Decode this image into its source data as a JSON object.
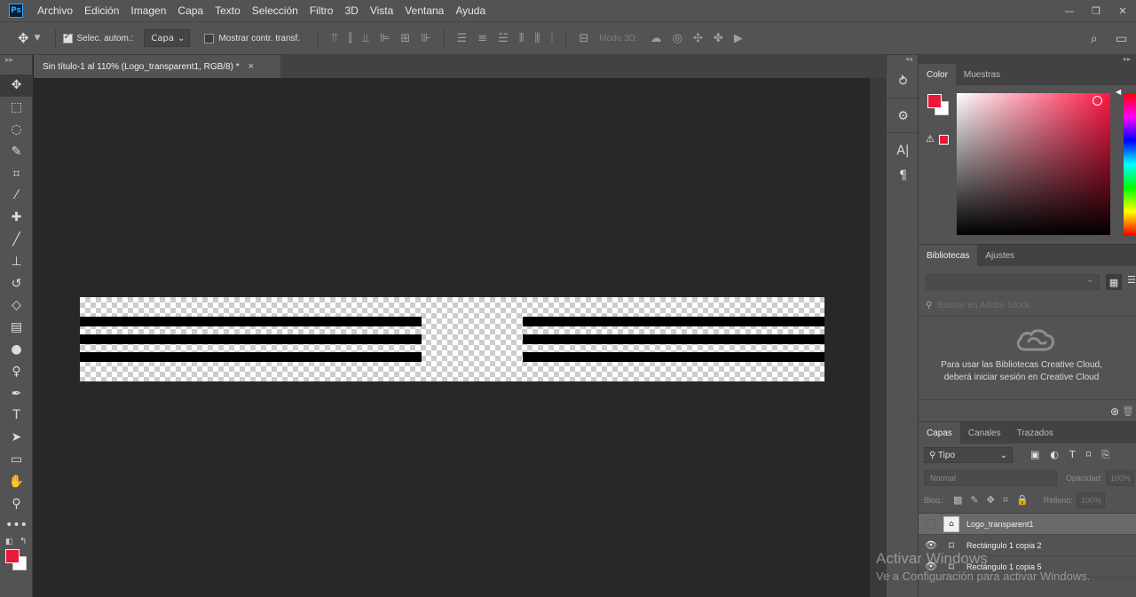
{
  "app": {
    "logo": "Ps",
    "menu": [
      "Archivo",
      "Edición",
      "Imagen",
      "Capa",
      "Texto",
      "Selección",
      "Filtro",
      "3D",
      "Vista",
      "Ventana",
      "Ayuda"
    ],
    "window_controls": [
      "—",
      "❐",
      "✕"
    ]
  },
  "options": {
    "auto_select_label": "Selec. autom.:",
    "auto_select_target": "Capa",
    "show_transform_label": "Mostrar contr. transf.",
    "mode3d_label": "Modo 3D:"
  },
  "document": {
    "tab_title": "Sin título-1 al 110% (Logo_transparent1, RGB/8) *",
    "close": "×"
  },
  "color_panel": {
    "tabs": [
      "Color",
      "Muestras"
    ],
    "foreground": "#e8193a",
    "background": "#ffffff"
  },
  "libraries_panel": {
    "tabs": [
      "Bibliotecas",
      "Ajustes"
    ],
    "search_placeholder": "Buscar en Adobe Stock",
    "message_line1": "Para usar las Bibliotecas Creative Cloud,",
    "message_line2": "deberá iniciar sesión en Creative Cloud"
  },
  "layers_panel": {
    "tabs": [
      "Capas",
      "Canales",
      "Trazados"
    ],
    "filter_label": "Tipo",
    "blend_mode": "Normal",
    "opacity_label": "Opacidad:",
    "opacity_value": "100%",
    "lock_label": "Bloq.:",
    "fill_label": "Relleno:",
    "fill_value": "100%",
    "layers": [
      {
        "name": "Logo_transparent1",
        "visible": false,
        "selected": true
      },
      {
        "name": "Rectángulo 1 copia 2",
        "visible": true,
        "selected": false
      },
      {
        "name": "Rectángulo 1 copia 5",
        "visible": true,
        "selected": false
      }
    ]
  },
  "watermark": {
    "title": "Activar Windows",
    "subtitle": "Ve a Configuración para activar Windows."
  }
}
